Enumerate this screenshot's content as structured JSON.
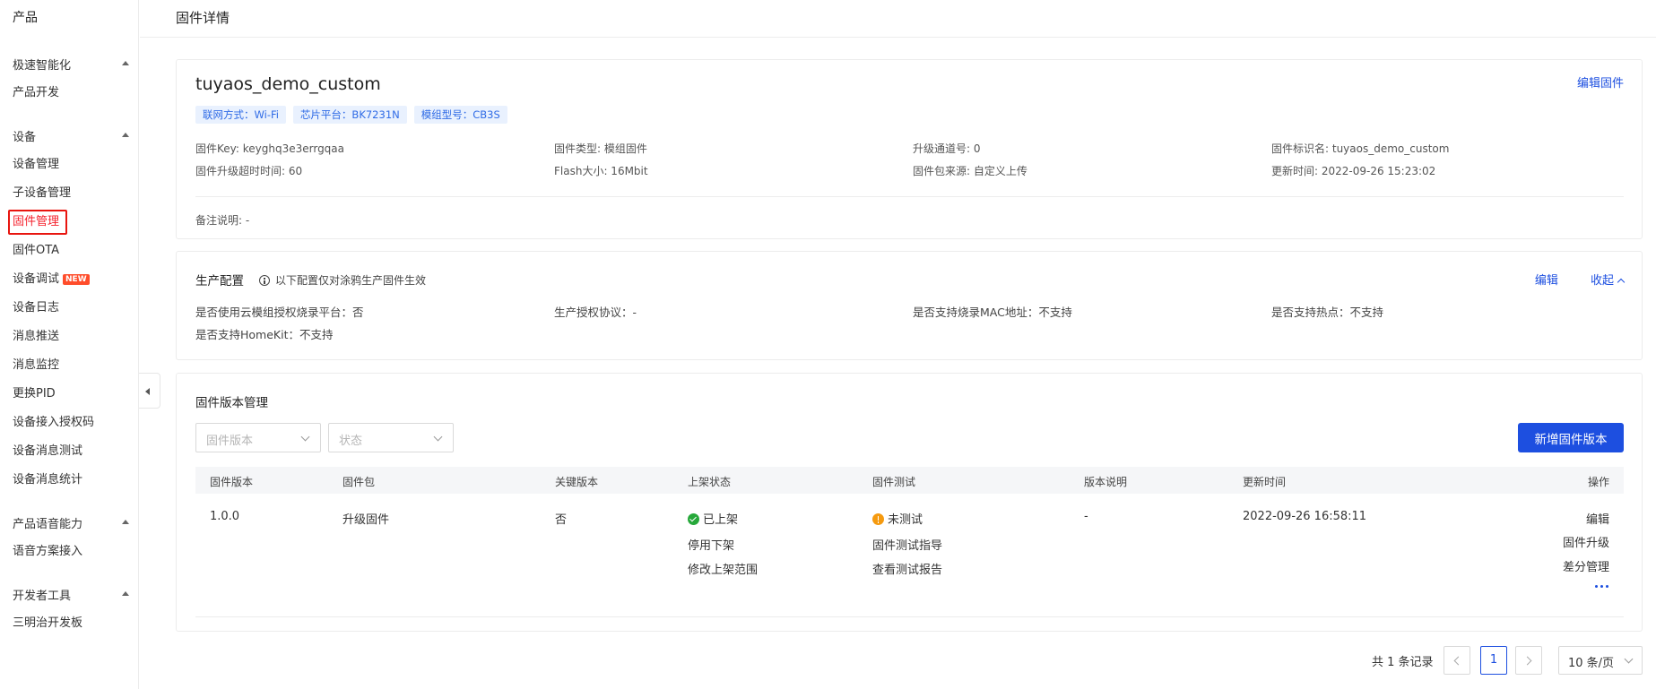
{
  "sidebar": {
    "brand": "产品",
    "groups": [
      {
        "title": "极速智能化",
        "items": [
          "产品开发"
        ]
      },
      {
        "title": "设备",
        "items": [
          "设备管理",
          "子设备管理",
          "固件管理",
          "固件OTA",
          "设备调试",
          "设备日志",
          "消息推送",
          "消息监控",
          "更换PID",
          "设备接入授权码",
          "设备消息测试",
          "设备消息统计"
        ]
      },
      {
        "title": "产品语音能力",
        "items": [
          "语音方案接入"
        ]
      },
      {
        "title": "开发者工具",
        "items": [
          "三明治开发板"
        ]
      }
    ],
    "active_item": "固件管理",
    "new_badge": "NEW"
  },
  "header": {
    "title": "固件详情"
  },
  "firmware": {
    "name": "tuyaos_demo_custom",
    "edit_label": "编辑固件",
    "tags": [
      "联网方式：Wi-Fi",
      "芯片平台：BK7231N",
      "模组型号：CB3S"
    ],
    "info": [
      "固件Key: keyghq3e3errgqaa",
      "固件类型: 模组固件",
      "升级通道号: 0",
      "固件标识名: tuyaos_demo_custom",
      "固件升级超时时间: 60",
      "Flash大小: 16Mbit",
      "固件包来源: 自定义上传",
      "更新时间: 2022-09-26 15:23:02"
    ],
    "remark": "备注说明: -"
  },
  "production": {
    "title": "生产配置",
    "notice": "以下配置仅对涂鸦生产固件生效",
    "edit_label": "编辑",
    "collapse_label": "收起",
    "info": [
      "是否使用云模组授权烧录平台：否",
      "生产授权协议：-",
      "是否支持烧录MAC地址：不支持",
      "是否支持热点：不支持",
      "是否支持HomeKit：不支持"
    ]
  },
  "versions": {
    "title": "固件版本管理",
    "filter_version_placeholder": "固件版本",
    "filter_status_placeholder": "状态",
    "add_button": "新增固件版本",
    "columns": [
      "固件版本",
      "固件包",
      "关键版本",
      "上架状态",
      "固件测试",
      "版本说明",
      "更新时间",
      "操作"
    ],
    "rows": [
      {
        "version": "1.0.0",
        "package": "升级固件",
        "key_version": "否",
        "status": "已上架",
        "status_actions": [
          "停用下架",
          "修改上架范围"
        ],
        "test_status": "未测试",
        "test_guide": "固件测试指导",
        "test_report": "查看测试报告",
        "notes": "-",
        "updated": "2022-09-26 16:58:11",
        "actions": [
          "编辑",
          "固件升级",
          "差分管理"
        ]
      }
    ]
  },
  "pagination": {
    "total": "共 1 条记录",
    "current": "1",
    "page_size": "10 条/页"
  },
  "colors": {
    "accent": "#1d4fe0",
    "active": "#f5222d",
    "success": "#26a83a",
    "warning": "#f59a0f"
  }
}
